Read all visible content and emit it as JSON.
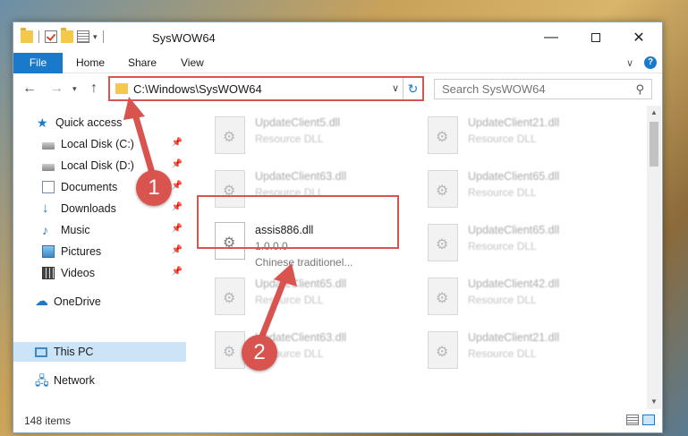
{
  "window": {
    "title": "SysWOW64",
    "controls": {
      "minimize": "—",
      "maximize": "",
      "close": "✕"
    }
  },
  "ribbon": {
    "tabs": [
      "File",
      "Home",
      "Share",
      "View"
    ]
  },
  "address": {
    "path": "C:\\Windows\\SysWOW64",
    "search_placeholder": "Search SysWOW64"
  },
  "nav": {
    "items": [
      {
        "label": "Quick access",
        "icon": "star-icon"
      },
      {
        "label": "Local Disk (C:)",
        "icon": "disk-icon",
        "pinned": true
      },
      {
        "label": "Local Disk (D:)",
        "icon": "disk-icon",
        "pinned": true
      },
      {
        "label": "Documents",
        "icon": "documents-icon",
        "pinned": true
      },
      {
        "label": "Downloads",
        "icon": "download-icon",
        "pinned": true
      },
      {
        "label": "Music",
        "icon": "music-icon",
        "pinned": true
      },
      {
        "label": "Pictures",
        "icon": "pictures-icon",
        "pinned": true
      },
      {
        "label": "Videos",
        "icon": "videos-icon",
        "pinned": true
      },
      {
        "label": "OneDrive",
        "icon": "cloud-icon"
      },
      {
        "label": "This PC",
        "icon": "computer-icon",
        "selected": true
      },
      {
        "label": "Network",
        "icon": "network-icon"
      }
    ]
  },
  "files": [
    {
      "name": "UpdateClient5.dll",
      "desc": "Resource DLL"
    },
    {
      "name": "UpdateClient21.dll",
      "desc": "Resource DLL"
    },
    {
      "name": "UpdateClient63.dll",
      "desc": "Resource DLL"
    },
    {
      "name": "UpdateClient65.dll",
      "desc": "Resource DLL"
    },
    {
      "name": "assis886.dll",
      "version": "1.0.0.0",
      "desc": "Chinese traditionel..."
    },
    {
      "name": "UpdateClient65.dll",
      "desc": "Resource DLL"
    },
    {
      "name": "UpdateClient65.dll",
      "desc": "Resource DLL"
    },
    {
      "name": "UpdateClient42.dll",
      "desc": "Resource DLL"
    },
    {
      "name": "UpdateClient63.dll",
      "desc": "Resource DLL"
    },
    {
      "name": "UpdateClient21.dll",
      "desc": "Resource DLL"
    }
  ],
  "status": {
    "item_count": "148 items"
  },
  "annotations": {
    "step1": "1",
    "step2": "2",
    "color": "#d9534f"
  }
}
